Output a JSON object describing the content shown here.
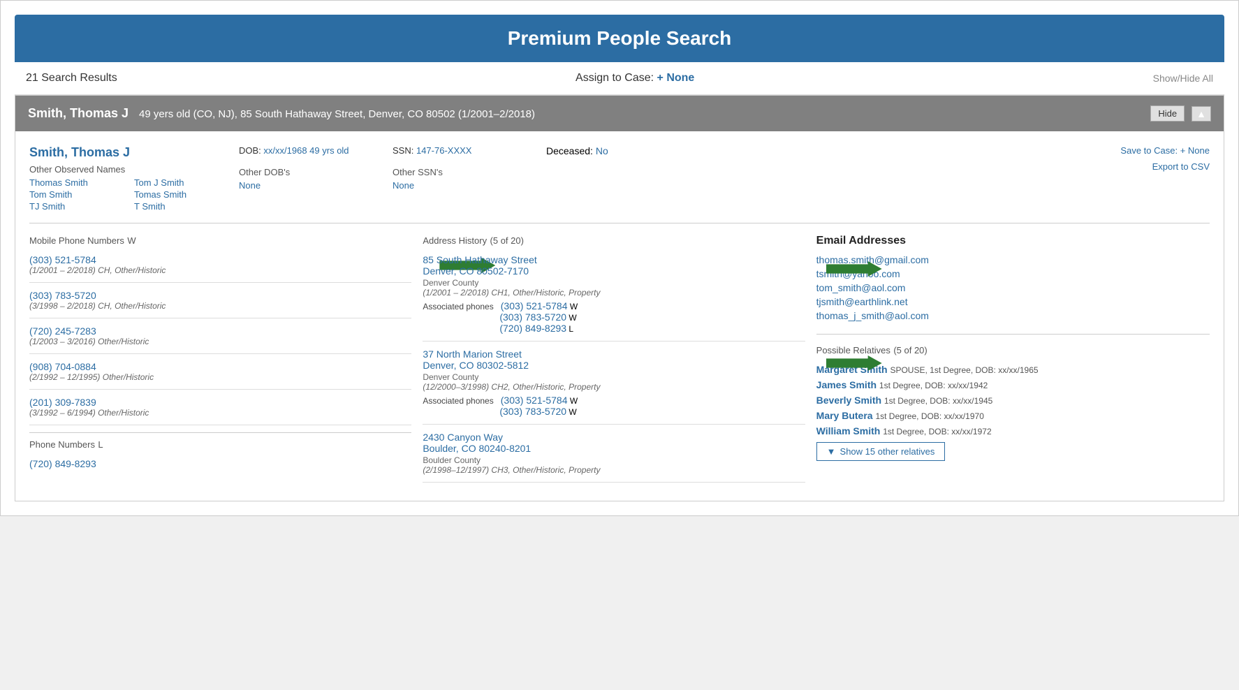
{
  "header": {
    "title": "Premium People Search"
  },
  "toolbar": {
    "results_count": "21 Search Results",
    "assign_label": "Assign to Case:",
    "assign_plus": "+",
    "assign_case": "None",
    "showhide": "Show/Hide All"
  },
  "result": {
    "header_name": "Smith, Thomas J",
    "header_details": "49 yers old (CO, NJ), 85 South Hathaway Street, Denver, CO 80502 (1/2001–2/2018)",
    "hide_label": "Hide",
    "primary_name": "Smith, Thomas J",
    "other_names_label": "Other Observed Names",
    "other_names": [
      {
        "name": "Thomas Smith",
        "col": 1
      },
      {
        "name": "Tom J Smith",
        "col": 2
      },
      {
        "name": "Tom Smith",
        "col": 1
      },
      {
        "name": "Tomas Smith",
        "col": 2
      },
      {
        "name": "TJ Smith",
        "col": 1
      },
      {
        "name": "T Smith",
        "col": 2
      }
    ],
    "dob_label": "DOB:",
    "dob_value": "xx/xx/1968 49 yrs old",
    "other_dobs_label": "Other DOB's",
    "other_dobs_value": "None",
    "ssn_label": "SSN:",
    "ssn_value": "147-76-XXXX",
    "other_ssns_label": "Other SSN's",
    "other_ssns_value": "None",
    "deceased_label": "Deceased:",
    "deceased_value": "No",
    "save_label": "Save to Case:",
    "save_plus": "+",
    "save_case": "None",
    "export_label": "Export to CSV",
    "mobile_phones_title": "Mobile Phone Numbers",
    "mobile_phones_badge": "W",
    "mobile_phones": [
      {
        "number": "(303) 521-5784",
        "details": "(1/2001 – 2/2018) CH, Other/Historic",
        "arrow": true
      },
      {
        "number": "(303) 783-5720",
        "details": "(3/1998 – 2/2018) CH, Other/Historic",
        "arrow": false
      },
      {
        "number": "(720) 245-7283",
        "details": "(1/2003 – 3/2016) Other/Historic",
        "arrow": false
      },
      {
        "number": "(908) 704-0884",
        "details": "(2/1992 – 12/1995) Other/Historic",
        "arrow": false
      },
      {
        "number": "(201) 309-7839",
        "details": "(3/1992 – 6/1994) Other/Historic",
        "arrow": false
      }
    ],
    "phone_numbers_title": "Phone Numbers",
    "phone_numbers_badge": "L",
    "phone_numbers_first": "(720) 849-8293",
    "address_history_title": "Address History",
    "address_history_count": "(5 of 20)",
    "addresses": [
      {
        "address": "85 South Hathaway Street",
        "city_state_zip": "Denver, CO 80502-7170",
        "county": "Denver County",
        "details": "(1/2001 – 2/2018) CH1, Other/Historic, Property",
        "assoc_phones": [
          {
            "number": "(303) 521-5784",
            "badge": "W"
          },
          {
            "number": "(303) 783-5720",
            "badge": "W"
          },
          {
            "number": "(720) 849-8293",
            "badge": "L"
          }
        ],
        "arrow": true
      },
      {
        "address": "37 North Marion Street",
        "city_state_zip": "Denver, CO 80302-5812",
        "county": "Denver County",
        "details": "(12/2000–3/1998) CH2, Other/Historic, Property",
        "assoc_phones": [
          {
            "number": "(303) 521-5784",
            "badge": "W"
          },
          {
            "number": "(303) 783-5720",
            "badge": "W"
          }
        ],
        "arrow": true
      },
      {
        "address": "2430 Canyon Way",
        "city_state_zip": "Boulder, CO 80240-8201",
        "county": "Boulder County",
        "details": "(2/1998–12/1997) CH3, Other/Historic, Property",
        "assoc_phones": [],
        "arrow": false
      }
    ],
    "email_title": "Email Addresses",
    "emails": [
      "thomas.smith@gmail.com",
      "tsmith@yahoo.com",
      "tom_smith@aol.com",
      "tjsmith@earthlink.net",
      "thomas_j_smith@aol.com"
    ],
    "relatives_title": "Possible Relatives",
    "relatives_count": "(5 of 20)",
    "relatives": [
      {
        "name": "Margaret Smith",
        "detail": "SPOUSE, 1st Degree, DOB: xx/xx/1965"
      },
      {
        "name": "James Smith",
        "detail": "1st Degree, DOB: xx/xx/1942"
      },
      {
        "name": "Beverly Smith",
        "detail": "1st Degree, DOB: xx/xx/1945"
      },
      {
        "name": "Mary Butera",
        "detail": "1st Degree, DOB: xx/xx/1970"
      },
      {
        "name": "William Smith",
        "detail": "1st Degree, DOB: xx/xx/1972"
      }
    ],
    "show_relatives_label": "Show 15 other relatives",
    "assoc_phones_label": "Associated phones"
  }
}
